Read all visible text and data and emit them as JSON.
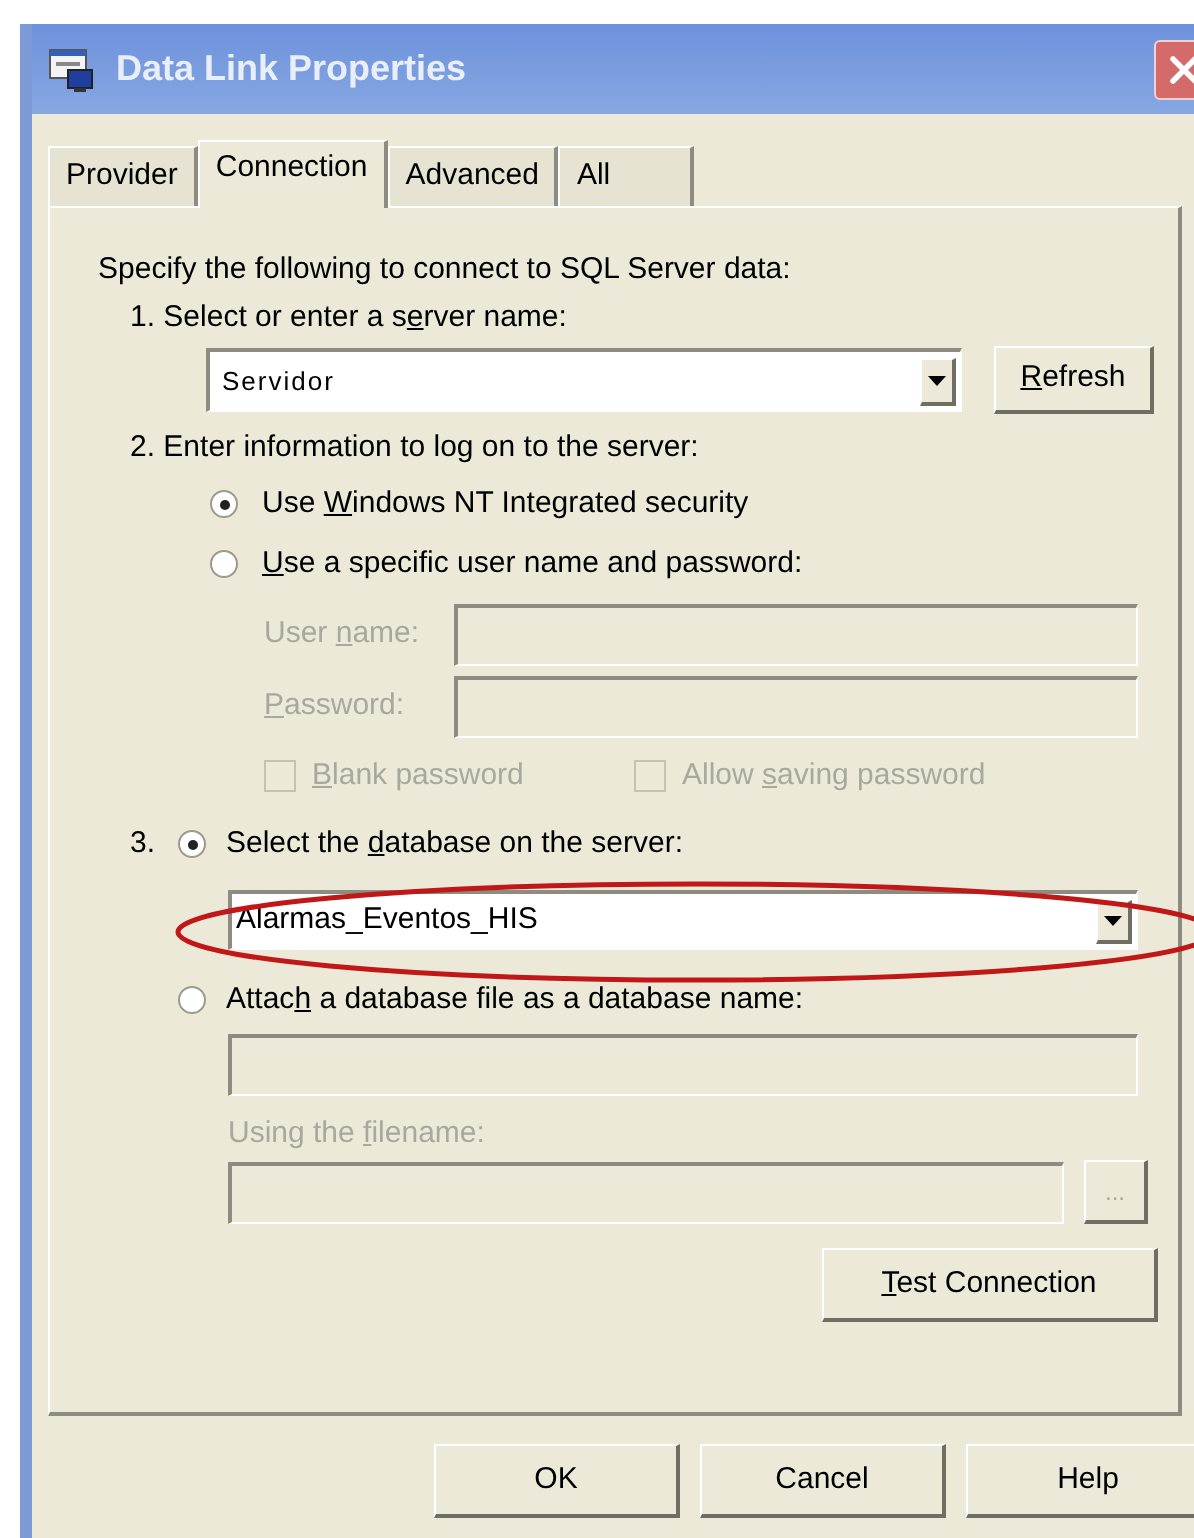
{
  "window": {
    "title": "Data Link Properties"
  },
  "tabs": [
    {
      "label": "Provider",
      "selected": false
    },
    {
      "label": "Connection",
      "selected": true
    },
    {
      "label": "Advanced",
      "selected": false
    },
    {
      "label": "All",
      "selected": false
    }
  ],
  "intro": "Specify the following to connect to SQL Server data:",
  "server": {
    "label": {
      "before": "1. Select or enter a s",
      "key": "e",
      "after": "rver name:"
    },
    "value": "Servidor",
    "refresh_button": {
      "key": "R",
      "after": "efresh"
    }
  },
  "login": {
    "label": "2. Enter information to log on to the server:",
    "options": [
      {
        "label": {
          "before": "Use ",
          "key": "W",
          "after": "indows NT Integrated security"
        },
        "selected": true
      },
      {
        "label": {
          "key": "U",
          "after": "se a specific user name and password:"
        },
        "selected": false
      }
    ],
    "user_name": {
      "label": {
        "before": "User ",
        "key": "n",
        "after": "ame:"
      },
      "disabled": true
    },
    "password": {
      "label": {
        "key": "P",
        "after": "assword:"
      },
      "disabled": true
    },
    "checkboxes": [
      {
        "label": {
          "key": "B",
          "after": "lank password"
        },
        "checked": false,
        "disabled": true
      },
      {
        "label": {
          "before": "Allow ",
          "key": "s",
          "after": "aving password"
        },
        "checked": false,
        "disabled": true
      }
    ]
  },
  "database": {
    "number": "3.",
    "options": [
      {
        "label": {
          "before": "Select the ",
          "key": "d",
          "after": "atabase on the server:"
        },
        "selected": true,
        "value": "Alarmas_Eventos_HIS"
      },
      {
        "label": {
          "before": "Attac",
          "key": "h",
          "after": " a database file as a database name:"
        },
        "selected": false
      }
    ],
    "attach": {
      "filename_label": {
        "before": "Using the ",
        "key": "f",
        "after": "ilename:"
      },
      "browse_button": "...",
      "disabled": true
    }
  },
  "test_button": {
    "key": "T",
    "after": "est Connection"
  },
  "buttons": [
    "OK",
    "Cancel",
    "Help"
  ]
}
